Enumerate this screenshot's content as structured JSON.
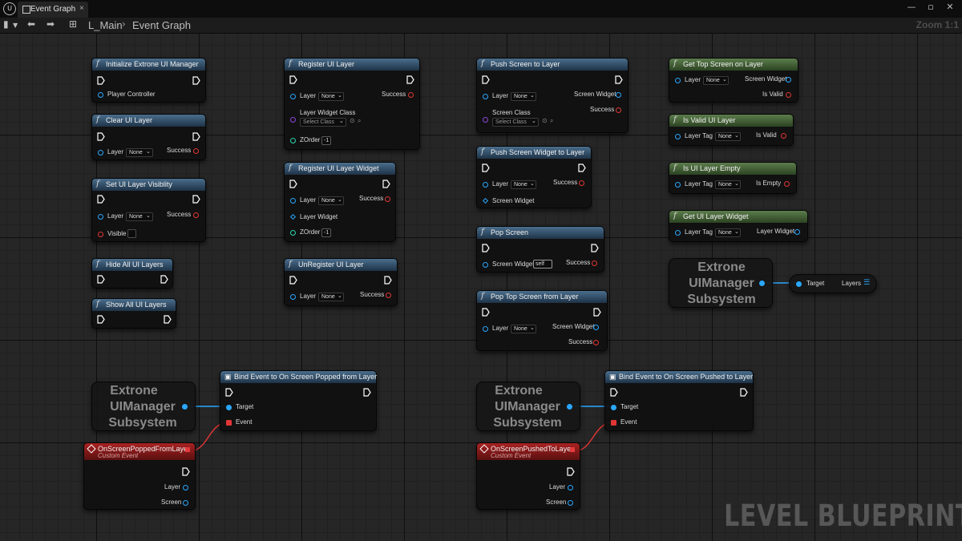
{
  "window": {
    "logo": "U",
    "tab_label": "Event Graph",
    "tab_close": "×",
    "minimize": "—",
    "maximize": "▫",
    "close": "✕"
  },
  "toolbar": {
    "breadcrumb_root": "L_Main",
    "breadcrumb_separator": "›",
    "breadcrumb_current": "Event Graph",
    "zoom_label": "Zoom 1:1"
  },
  "watermark": "LEVEL BLUEPRINT",
  "common": {
    "none": "None",
    "select_class": "Select Class",
    "self": "self",
    "minus_one": "-1",
    "func_icon": "f"
  },
  "nodes": {
    "initialize": {
      "title": "Initialize Extrone UI Manager",
      "pin": "Player Controller"
    },
    "clear_layer": {
      "title": "Clear UI Layer",
      "layer": "Layer",
      "success": "Success"
    },
    "set_visibility": {
      "title": "Set UI Layer Visiblity",
      "layer": "Layer",
      "success": "Success",
      "visible": "Visible"
    },
    "hide_all": {
      "title": "Hide All UI Layers"
    },
    "show_all": {
      "title": "Show All UI Layers"
    },
    "register_layer": {
      "title": "Register UI Layer",
      "layer": "Layer",
      "success": "Success",
      "class": "Layer Widget Class",
      "zorder": "ZOrder"
    },
    "register_widget": {
      "title": "Register UI Layer Widget",
      "layer": "Layer",
      "success": "Success",
      "widget": "Layer Widget",
      "zorder": "ZOrder"
    },
    "unregister": {
      "title": "UnRegister UI Layer",
      "layer": "Layer",
      "success": "Success"
    },
    "push_screen": {
      "title": "Push Screen to Layer",
      "layer": "Layer",
      "screen_widget": "Screen Widget",
      "success": "Success",
      "screen_class": "Screen Class"
    },
    "push_widget": {
      "title": "Push Screen Widget to Layer",
      "layer": "Layer",
      "success": "Success",
      "screen_widget": "Screen Widget"
    },
    "pop_screen": {
      "title": "Pop Screen",
      "screen_widget": "Screen Widget",
      "success": "Success"
    },
    "pop_top": {
      "title": "Pop Top Screen from Layer",
      "layer": "Layer",
      "screen_widget": "Screen Widget",
      "success": "Success"
    },
    "get_top": {
      "title": "Get Top Screen on Layer",
      "layer": "Layer",
      "screen_widget": "Screen Widget",
      "is_valid": "Is Valid"
    },
    "is_valid_layer": {
      "title": "Is Valid UI Layer",
      "layer_tag": "Layer Tag",
      "is_valid": "Is Valid"
    },
    "is_empty": {
      "title": "Is UI Layer Empty",
      "layer_tag": "Layer Tag",
      "is_empty": "Is Empty"
    },
    "get_widget": {
      "title": "Get UI Layer Widget",
      "layer_tag": "Layer Tag",
      "layer_widget": "Layer Widget"
    },
    "subsystem_1": {
      "line1": "Extrone",
      "line2": "UIManager",
      "line3": "Subsystem"
    },
    "layers_getter": {
      "target": "Target",
      "layers": "Layers"
    },
    "subsystem_2": {
      "line1": "Extrone",
      "line2": "UIManager",
      "line3": "Subsystem"
    },
    "bind_popped": {
      "title": "Bind Event to On Screen Popped from Layer",
      "target": "Target",
      "event": "Event"
    },
    "subsystem_3": {
      "line1": "Extrone",
      "line2": "UIManager",
      "line3": "Subsystem"
    },
    "bind_pushed": {
      "title": "Bind Event to On Screen Pushed to Layer",
      "target": "Target",
      "event": "Event"
    },
    "event_popped": {
      "title": "OnScreenPoppedFromLayer",
      "subtitle": "Custom Event",
      "layer": "Layer",
      "screen": "Screen"
    },
    "event_pushed": {
      "title": "OnScreenPushedToLayer",
      "subtitle": "Custom Event",
      "layer": "Layer",
      "screen": "Screen"
    }
  },
  "colors": {
    "function_header": "#2f4b66",
    "pure_header": "#4a6a3a",
    "event_header": "#8a1a1a",
    "object_pin": "#2aa7ff",
    "bool_pin": "#e23636",
    "class_pin": "#8f45d8",
    "int_pin": "#2ed6b0"
  }
}
